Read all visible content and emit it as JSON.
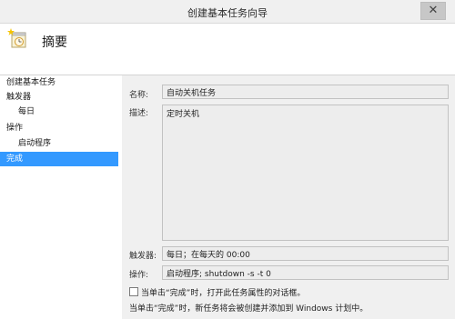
{
  "window": {
    "title": "创建基本任务向导",
    "close_symbol": "✕"
  },
  "header": {
    "heading": "摘要",
    "icon": "task-wizard-clock-icon"
  },
  "sidebar": {
    "items": [
      {
        "label": "创建基本任务",
        "level": 1,
        "active": false
      },
      {
        "label": "触发器",
        "level": 1,
        "active": false
      },
      {
        "label": "每日",
        "level": 2,
        "active": false
      },
      {
        "label": "操作",
        "level": 1,
        "active": false
      },
      {
        "label": "启动程序",
        "level": 2,
        "active": false
      },
      {
        "label": "完成",
        "level": 1,
        "active": true
      }
    ]
  },
  "form": {
    "name_label": "名称:",
    "name_value": "自动关机任务",
    "desc_label": "描述:",
    "desc_value": "定时关机",
    "trigger_label": "触发器:",
    "trigger_value": "每日；在每天的 00:00",
    "action_label": "操作:",
    "action_value": "启动程序; shutdown -s -t 0"
  },
  "checkbox": {
    "label": "当单击“完成”时，打开此任务属性的对话框。",
    "checked": false
  },
  "note": "当单击“完成”时，新任务将会被创建并添加到 Windows 计划中。",
  "colors": {
    "accent": "#3399ff",
    "sidebar_bg": "#ffffff",
    "window_bg": "#f0f0f0"
  }
}
